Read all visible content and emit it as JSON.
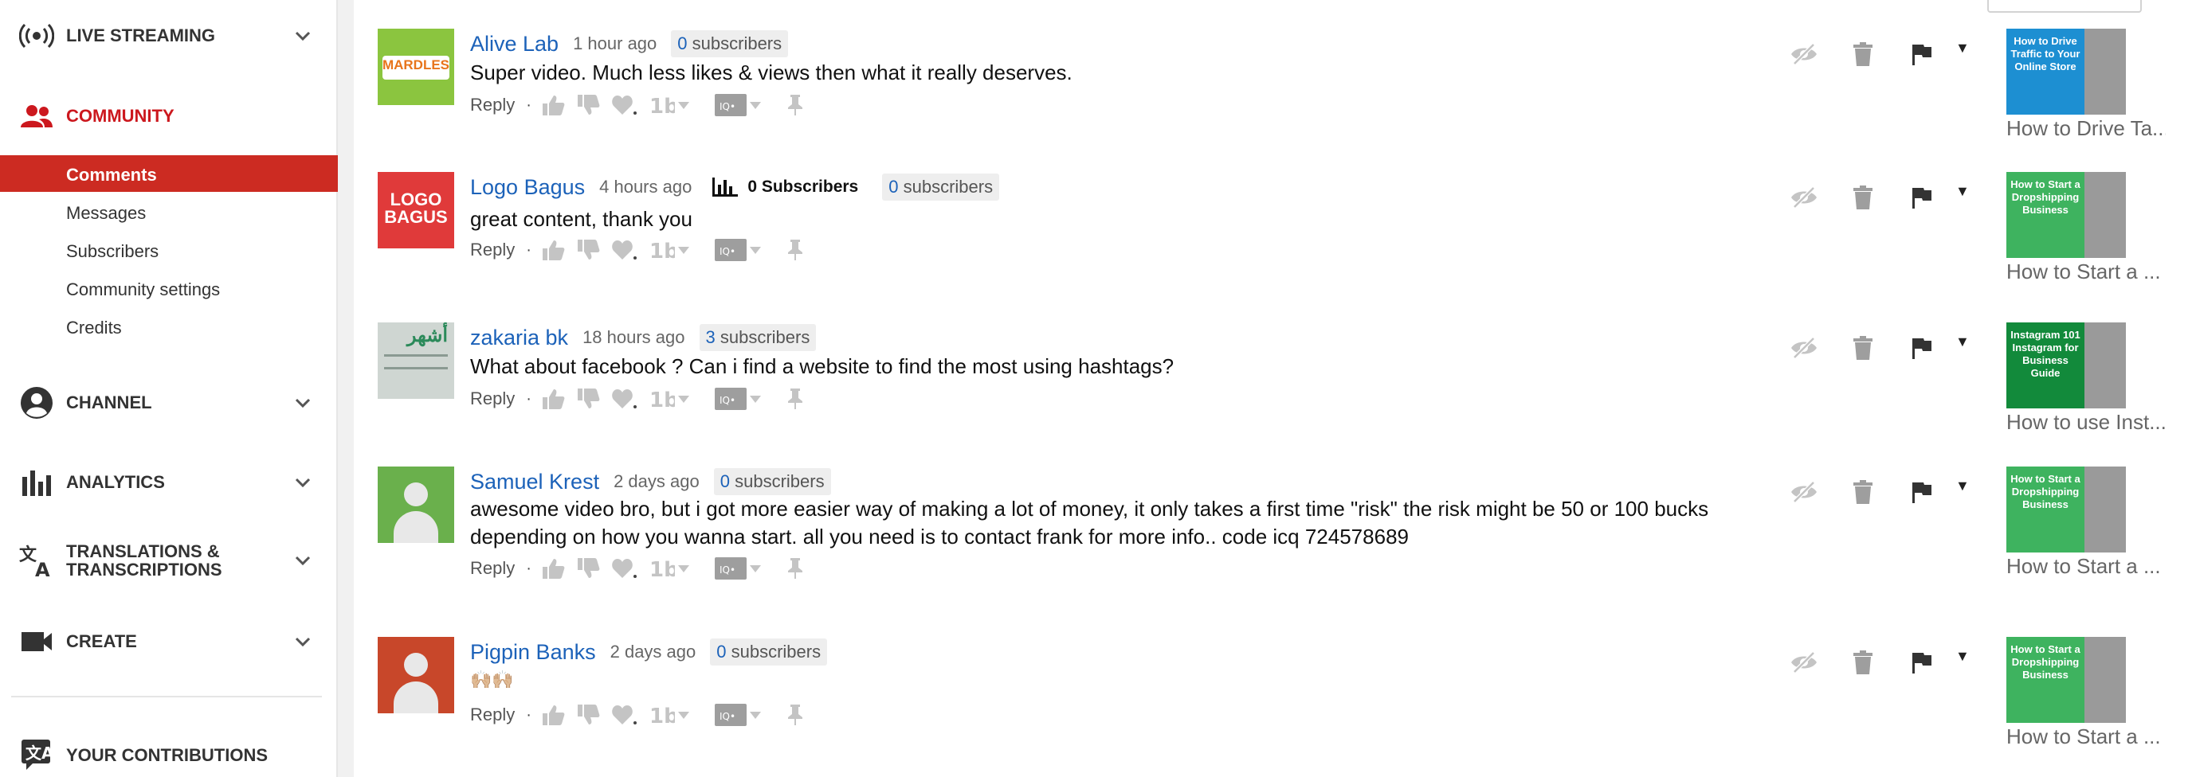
{
  "sidebar": {
    "live_streaming": "LIVE STREAMING",
    "community": "COMMUNITY",
    "sub_items": [
      "Comments",
      "Messages",
      "Subscribers",
      "Community settings",
      "Credits"
    ],
    "channel": "CHANNEL",
    "analytics": "ANALYTICS",
    "translations_line1": "TRANSLATIONS &",
    "translations_line2": "TRANSCRIPTIONS",
    "create": "CREATE",
    "your_contributions": "YOUR CONTRIBUTIONS"
  },
  "actions": {
    "reply": "Reply",
    "dot": "·"
  },
  "comments": [
    {
      "author": "Alive Lab",
      "time": "1 hour ago",
      "subscriber_count": "0",
      "subscriber_label": "subscribers",
      "text": "Super video. Much less likes & views  then what it really deserves.",
      "avatar_color": "#8bc53f",
      "avatar_text": "MARDLES",
      "thumb_text": "How to Drive Traffic to Your Online Store",
      "video_title": "How to Drive Ta..."
    },
    {
      "author": "Logo Bagus",
      "time": "4 hours ago",
      "stat_label": "0 Subscribers",
      "subscriber_count": "0",
      "subscriber_label": "subscribers",
      "text": "great content, thank you",
      "avatar_color": "#e03a3a",
      "avatar_text": "LOGO BAGUS",
      "thumb_text": "How to Start a Dropshipping Business",
      "video_title": "How to Start a ..."
    },
    {
      "author": "zakaria bk",
      "time": "18 hours ago",
      "subscriber_count": "3",
      "subscriber_label": "subscribers",
      "text": "What about facebook ? Can i find a website to find the most using hashtags?",
      "avatar_color": "#cfd6d2",
      "avatar_text": "أشهر",
      "thumb_text": "Instagram 101 Instagram for Business Guide",
      "video_title": "How to use Inst..."
    },
    {
      "author": "Samuel Krest",
      "time": "2 days ago",
      "subscriber_count": "0",
      "subscriber_label": "subscribers",
      "text": "awesome video bro, but i got more easier way of making a lot of money, it only takes a first time \"risk\" the risk might be 50 or 100 bucks depending on how you wanna start. all you need is to contact frank for more info..    code icq 724578689",
      "avatar_color": "#6ab04c",
      "thumb_text": "How to Start a Dropshipping Business",
      "video_title": "How to Start a ..."
    },
    {
      "author": "Pigpin Banks",
      "time": "2 days ago",
      "subscriber_count": "0",
      "subscriber_label": "subscribers",
      "text": "🙌🏼🙌🏼",
      "avatar_color": "#c8472a",
      "thumb_text": "How to Start a Dropshipping Business",
      "video_title": "How to Start a ..."
    }
  ],
  "colors": {
    "accent_red": "#cc181e",
    "link_blue": "#1c62b9",
    "selected_bg": "#cc2b22"
  }
}
